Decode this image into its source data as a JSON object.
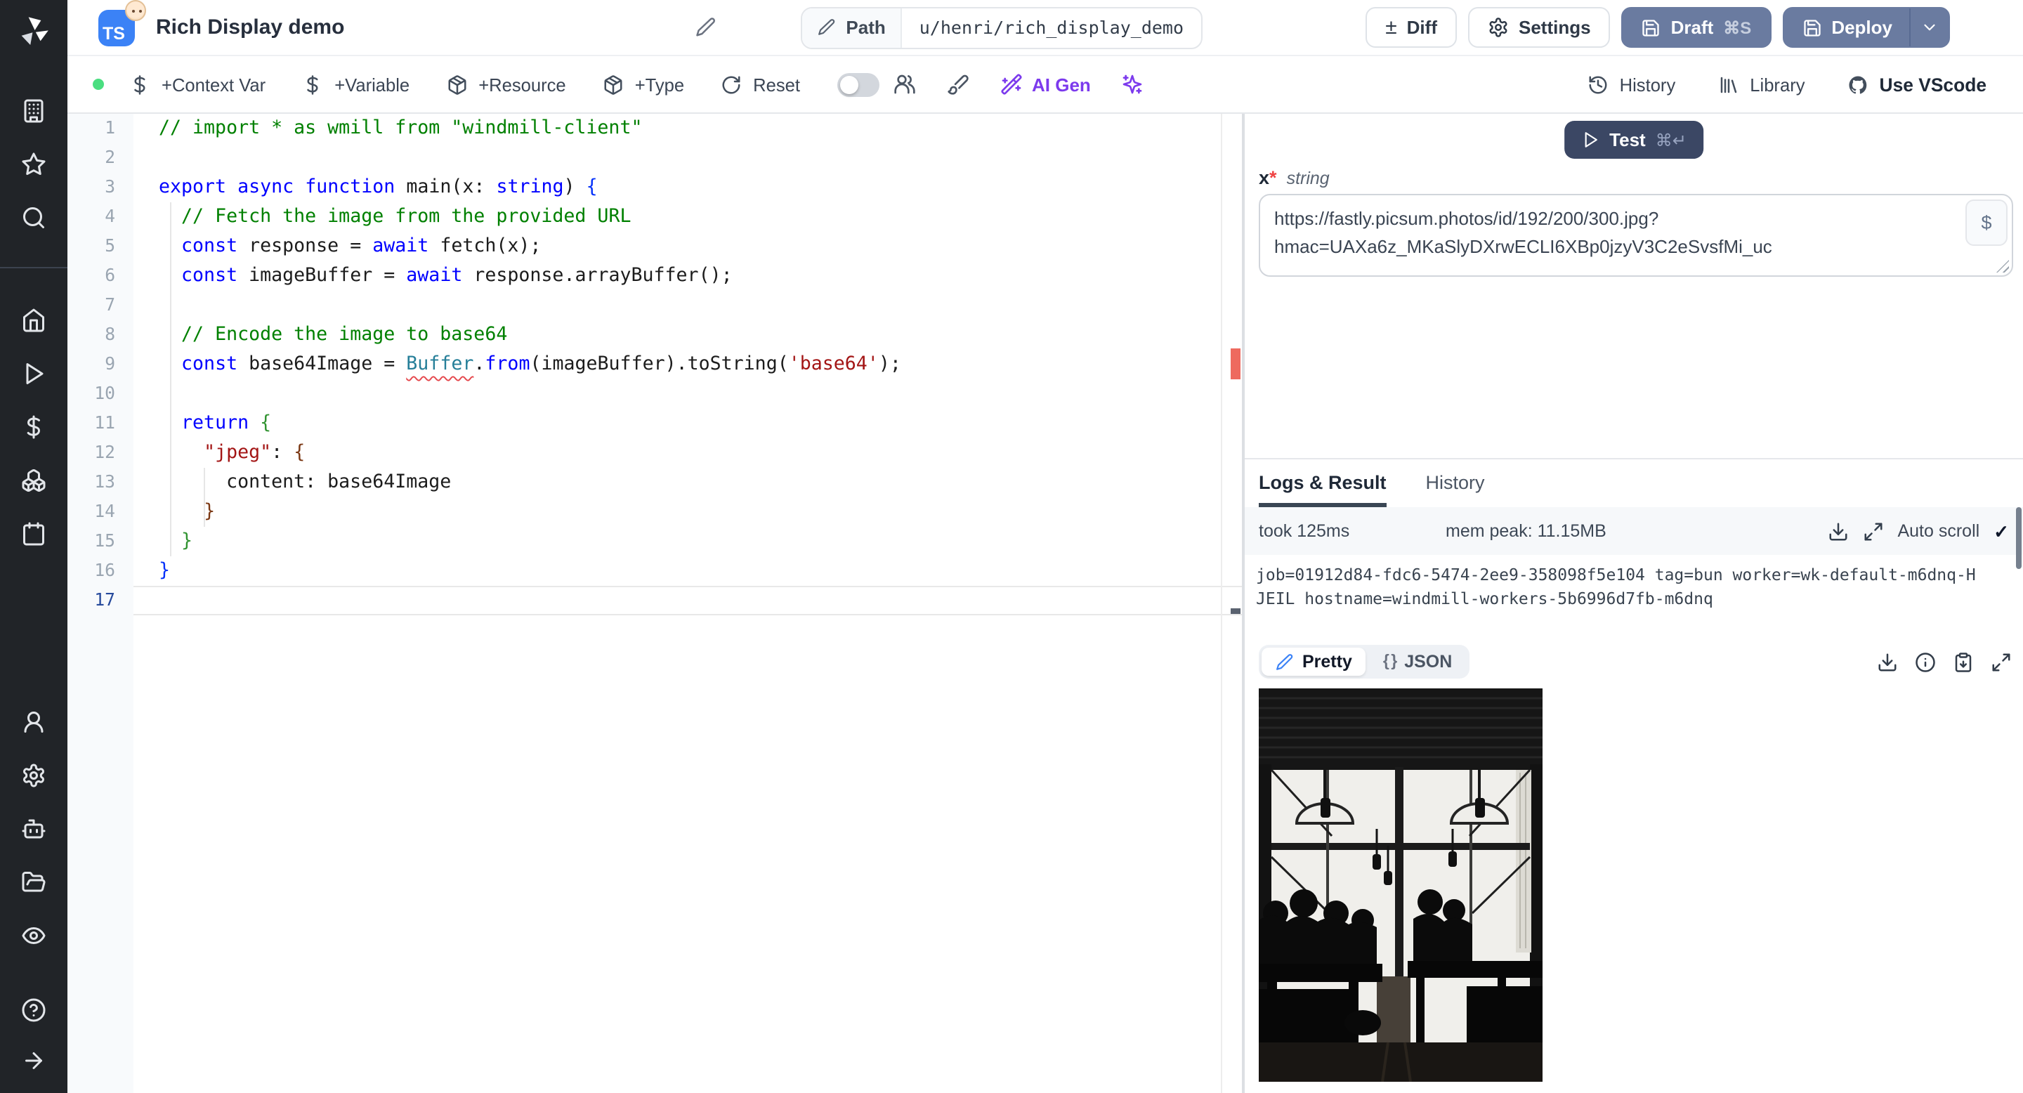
{
  "colors": {
    "accent_blue": "#3b82f6",
    "button_slate": "#6a7ba0",
    "button_navy": "#3b4764",
    "ai_purple": "#7c3aed",
    "status_green": "#4ade80",
    "error_red": "#e5484d"
  },
  "sidebar": {
    "logo_icon": "windmill-logo",
    "top": [
      "building",
      "star",
      "search"
    ],
    "mid": [
      "home",
      "play",
      "dollar",
      "boxes",
      "calendar"
    ],
    "lower": [
      "user",
      "settings",
      "bot",
      "folder-open",
      "eye"
    ],
    "bottom": [
      "help-circle",
      "arrow-right"
    ]
  },
  "topbar": {
    "badge": "TS",
    "emoji": "baby",
    "title": "Rich Display demo",
    "path_label": "Path",
    "path_value": "u/henri/rich_display_demo",
    "diff": "Diff",
    "settings": "Settings",
    "draft": "Draft",
    "draft_kbd": "⌘S",
    "deploy": "Deploy"
  },
  "toolbar": {
    "insert_buttons": [
      {
        "icon": "dollar",
        "label": "+Context Var"
      },
      {
        "icon": "dollar",
        "label": "+Variable"
      },
      {
        "icon": "package",
        "label": "+Resource"
      },
      {
        "icon": "package",
        "label": "+Type"
      },
      {
        "icon": "refresh",
        "label": "Reset"
      }
    ],
    "ai_gen": "AI Gen",
    "right_buttons": [
      {
        "icon": "history",
        "label": "History",
        "strong": false
      },
      {
        "icon": "library",
        "label": "Library",
        "strong": false
      },
      {
        "icon": "github",
        "label": "Use VScode",
        "strong": true
      }
    ]
  },
  "editor": {
    "active_line": 17,
    "lines": [
      {
        "n": 1,
        "segs": [
          {
            "c": "c",
            "t": "// import * as wmill from \"windmill-client\""
          }
        ]
      },
      {
        "n": 2,
        "segs": []
      },
      {
        "n": 3,
        "segs": [
          {
            "c": "k",
            "t": "export"
          },
          {
            "c": "p",
            "t": " "
          },
          {
            "c": "k",
            "t": "async"
          },
          {
            "c": "p",
            "t": " "
          },
          {
            "c": "k",
            "t": "function"
          },
          {
            "c": "p",
            "t": " main(x: "
          },
          {
            "c": "k",
            "t": "string"
          },
          {
            "c": "p",
            "t": ") "
          },
          {
            "c": "b1",
            "t": "{"
          }
        ]
      },
      {
        "n": 4,
        "segs": [
          {
            "c": "p",
            "t": "  "
          },
          {
            "c": "c",
            "t": "// Fetch the image from the provided URL"
          }
        ]
      },
      {
        "n": 5,
        "segs": [
          {
            "c": "p",
            "t": "  "
          },
          {
            "c": "k",
            "t": "const"
          },
          {
            "c": "p",
            "t": " response = "
          },
          {
            "c": "k",
            "t": "await"
          },
          {
            "c": "p",
            "t": " fetch(x);"
          }
        ]
      },
      {
        "n": 6,
        "segs": [
          {
            "c": "p",
            "t": "  "
          },
          {
            "c": "k",
            "t": "const"
          },
          {
            "c": "p",
            "t": " imageBuffer = "
          },
          {
            "c": "k",
            "t": "await"
          },
          {
            "c": "p",
            "t": " response.arrayBuffer();"
          }
        ]
      },
      {
        "n": 7,
        "segs": []
      },
      {
        "n": 8,
        "segs": [
          {
            "c": "p",
            "t": "  "
          },
          {
            "c": "c",
            "t": "// Encode the image to base64"
          }
        ]
      },
      {
        "n": 9,
        "segs": [
          {
            "c": "p",
            "t": "  "
          },
          {
            "c": "k",
            "t": "const"
          },
          {
            "c": "p",
            "t": " base64Image = "
          },
          {
            "c": "e",
            "t": "Buffer"
          },
          {
            "c": "p",
            "t": "."
          },
          {
            "c": "k",
            "t": "from"
          },
          {
            "c": "p",
            "t": "(imageBuffer).toString("
          },
          {
            "c": "s",
            "t": "'base64'"
          },
          {
            "c": "p",
            "t": ");"
          }
        ]
      },
      {
        "n": 10,
        "segs": []
      },
      {
        "n": 11,
        "segs": [
          {
            "c": "p",
            "t": "  "
          },
          {
            "c": "k",
            "t": "return"
          },
          {
            "c": "p",
            "t": " "
          },
          {
            "c": "b2",
            "t": "{"
          }
        ]
      },
      {
        "n": 12,
        "segs": [
          {
            "c": "p",
            "t": "    "
          },
          {
            "c": "s",
            "t": "\"jpeg\""
          },
          {
            "c": "p",
            "t": ": "
          },
          {
            "c": "b3",
            "t": "{"
          }
        ]
      },
      {
        "n": 13,
        "segs": [
          {
            "c": "p",
            "t": "      content: base64Image"
          }
        ]
      },
      {
        "n": 14,
        "segs": [
          {
            "c": "p",
            "t": "    "
          },
          {
            "c": "b3",
            "t": "}"
          }
        ]
      },
      {
        "n": 15,
        "segs": [
          {
            "c": "p",
            "t": "  "
          },
          {
            "c": "b2",
            "t": "}"
          }
        ]
      },
      {
        "n": 16,
        "segs": [
          {
            "c": "b1",
            "t": "}"
          }
        ]
      },
      {
        "n": 17,
        "segs": []
      }
    ]
  },
  "panel": {
    "test": "Test",
    "test_kbd": "⌘↵",
    "arg_name": "x",
    "arg_required": "*",
    "arg_type": "string",
    "arg_value": "https://fastly.picsum.photos/id/192/200/300.jpg?hmac=UAXa6z_MKaSlyDXrwECLI6XBp0jzyV3C2eSvsfMi_uc",
    "dollar_btn": "$",
    "tabs": [
      "Logs & Result",
      "History"
    ],
    "took": "took 125ms",
    "mem_peak": "mem peak: 11.15MB",
    "auto_scroll": "Auto scroll",
    "log": "job=01912d84-fdc6-5474-2ee9-358098f5e104 tag=bun worker=wk-default-m6dnq-HJEIL hostname=windmill-workers-5b6996d7fb-m6dnq",
    "result_view_pretty": "Pretty",
    "result_view_json": "JSON",
    "json_braces": "{ }"
  }
}
